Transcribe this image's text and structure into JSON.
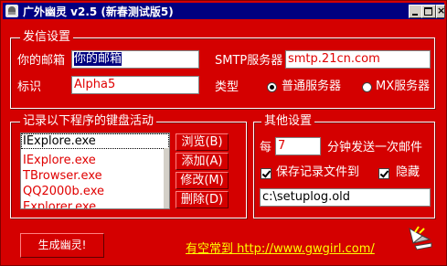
{
  "window": {
    "title": "广外幽灵 v2.5 (新春测试版5)"
  },
  "sender": {
    "group_title": "发信设置",
    "email_label": "你的邮箱",
    "email_value": "你的邮箱",
    "smtp_label": "SMTP服务器",
    "smtp_value": "smtp.21cn.com",
    "id_label": "标识",
    "id_value": "Alpha5",
    "type_label": "类型",
    "type_options": [
      {
        "label": "普通服务器",
        "selected": true
      },
      {
        "label": "MX服务器",
        "selected": false
      }
    ]
  },
  "keylog": {
    "group_title": "记录以下程序的键盘活动",
    "current_value": "IExplore.exe",
    "items": [
      "IExplore.exe",
      "TBrowser.exe",
      "QQ2000b.exe",
      "Explorer.exe"
    ],
    "buttons": {
      "browse": "浏览(B)",
      "add": "添加(A)",
      "modify": "修改(M)",
      "delete": "删除(D)"
    }
  },
  "other": {
    "group_title": "其他设置",
    "every_label": "每",
    "minutes_value": "7",
    "minutes_suffix": "分钟发送一次邮件",
    "save_log_label": "保存记录文件到",
    "save_log_checked": true,
    "hide_label": "隐藏",
    "hide_checked": true,
    "log_path": "c:\\setuplog.old"
  },
  "footer": {
    "generate_label": "生成幽灵!",
    "link_text": "有空常到 http://www.gwgirl.com/"
  },
  "colors": {
    "background": "#d40000",
    "text": "#ffffff",
    "link": "#ffff00",
    "titlebar": "#000080"
  }
}
